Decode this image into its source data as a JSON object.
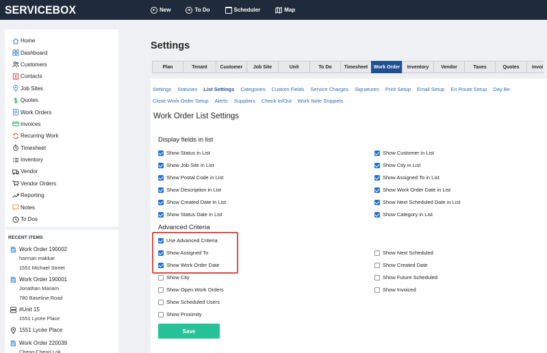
{
  "brand": {
    "logo": "SERVICEBOX"
  },
  "topnav": [
    {
      "label": "New",
      "icon": "plus-circle-icon"
    },
    {
      "label": "To Do",
      "icon": "plus-circle-icon"
    },
    {
      "label": "Scheduler",
      "icon": "calendar-icon"
    },
    {
      "label": "Map",
      "icon": "map-icon"
    }
  ],
  "sidebar": {
    "items": [
      {
        "label": "Home",
        "icon": "home-icon"
      },
      {
        "label": "Dashboard",
        "icon": "dashboard-icon"
      },
      {
        "label": "Customers",
        "icon": "customers-icon"
      },
      {
        "label": "Contacts",
        "icon": "contacts-icon"
      },
      {
        "label": "Job Sites",
        "icon": "location-pin-icon"
      },
      {
        "label": "Quotes",
        "icon": "dollar-icon"
      },
      {
        "label": "Work Orders",
        "icon": "work-orders-icon"
      },
      {
        "label": "Invoices",
        "icon": "invoice-icon"
      },
      {
        "label": "Recurring Work",
        "icon": "recurring-icon"
      },
      {
        "label": "Timesheet",
        "icon": "stopwatch-icon"
      },
      {
        "label": "Inventory",
        "icon": "list-icon"
      },
      {
        "label": "Vendor",
        "icon": "truck-icon"
      },
      {
        "label": "Vendor Orders",
        "icon": "cart-icon"
      },
      {
        "label": "Reporting",
        "icon": "trend-icon"
      },
      {
        "label": "Notes",
        "icon": "note-icon"
      },
      {
        "label": "To Dos",
        "icon": "clock-icon"
      }
    ]
  },
  "recent": {
    "title": "RECENT ITEMS",
    "items": [
      {
        "title": "Work Order 190002",
        "lines": [
          "harman makkar",
          "1551 Michael Street"
        ],
        "icon": "document-icon"
      },
      {
        "title": "Work Order 190001",
        "lines": [
          "Jonathan Mariam",
          "780 Baseline Road"
        ],
        "icon": "document-icon"
      },
      {
        "title": "#Unit 15",
        "lines": [
          "1551 Lycée Place"
        ],
        "icon": "unit-icon"
      },
      {
        "title": "1551 Lycée Place",
        "lines": [],
        "icon": "location-pin-icon"
      },
      {
        "title": "Work Order 220039",
        "lines": [
          "Cheng-Cheng Lok"
        ],
        "icon": "document-icon"
      }
    ]
  },
  "page": {
    "title": "Settings",
    "tabs": [
      "Plan",
      "Tenant",
      "Customer",
      "Job Site",
      "Unit",
      "To Do",
      "Timesheet",
      "Work Order",
      "Inventory",
      "Vendor",
      "Taxes",
      "Quotes",
      "Invoi"
    ],
    "active_tab": "Work Order",
    "sublinks_row1": [
      "Settings",
      "Statuses",
      "List Settings",
      "Categories",
      "Custom Fields",
      "Service Charges",
      "Signatures",
      "Print Setup",
      "Email Setup",
      "En Route Setup",
      "Day Be"
    ],
    "sublinks_row2": [
      "Close Work Order Setup",
      "Alerts",
      "Suppliers",
      "Check In/Out",
      "Work Note Snippets"
    ],
    "active_sublink": "List Settings",
    "section_title": "Work Order List Settings",
    "display_heading": "Display fields in list",
    "display_left": [
      {
        "label": "Show Status in List",
        "checked": true
      },
      {
        "label": "Show Job Site in List",
        "checked": true
      },
      {
        "label": "Show Postal Code in List",
        "checked": true
      },
      {
        "label": "Show Description in List",
        "checked": true
      },
      {
        "label": "Show Created Date in List",
        "checked": true
      },
      {
        "label": "Show Status Date in List",
        "checked": true
      }
    ],
    "display_right": [
      {
        "label": "Show Customer in List",
        "checked": true
      },
      {
        "label": "Show City in List",
        "checked": true
      },
      {
        "label": "Show Assigned To in List",
        "checked": true
      },
      {
        "label": "Show Work Order Date in List",
        "checked": true
      },
      {
        "label": "Show Next Scheduled Date in List",
        "checked": true
      },
      {
        "label": "Show Category in List",
        "checked": true
      }
    ],
    "advanced_heading": "Advanced Criteria",
    "advanced_left": [
      {
        "label": "Use Advanced Criteria",
        "checked": true
      },
      {
        "label": "Show Assigned To",
        "checked": true
      },
      {
        "label": "Show Work Order Date",
        "checked": true
      },
      {
        "label": "Show City",
        "checked": false
      },
      {
        "label": "Show Open Work Orders",
        "checked": false
      },
      {
        "label": "Show Scheduled Users",
        "checked": false
      },
      {
        "label": "Show Proximity",
        "checked": false
      }
    ],
    "advanced_right": [
      {
        "label": "Show Next Scheduled",
        "checked": false
      },
      {
        "label": "Show Created Date",
        "checked": false
      },
      {
        "label": "Show Future Scheduled",
        "checked": false
      },
      {
        "label": "Show Invoiced",
        "checked": false
      }
    ],
    "save_label": "Save"
  },
  "colors": {
    "topbar": "#1f2a3a",
    "active_tab": "#1f4f8f",
    "link": "#2a6db5",
    "checkbox": "#1e6fd9",
    "save": "#26c196",
    "highlight": "#e0493f"
  }
}
